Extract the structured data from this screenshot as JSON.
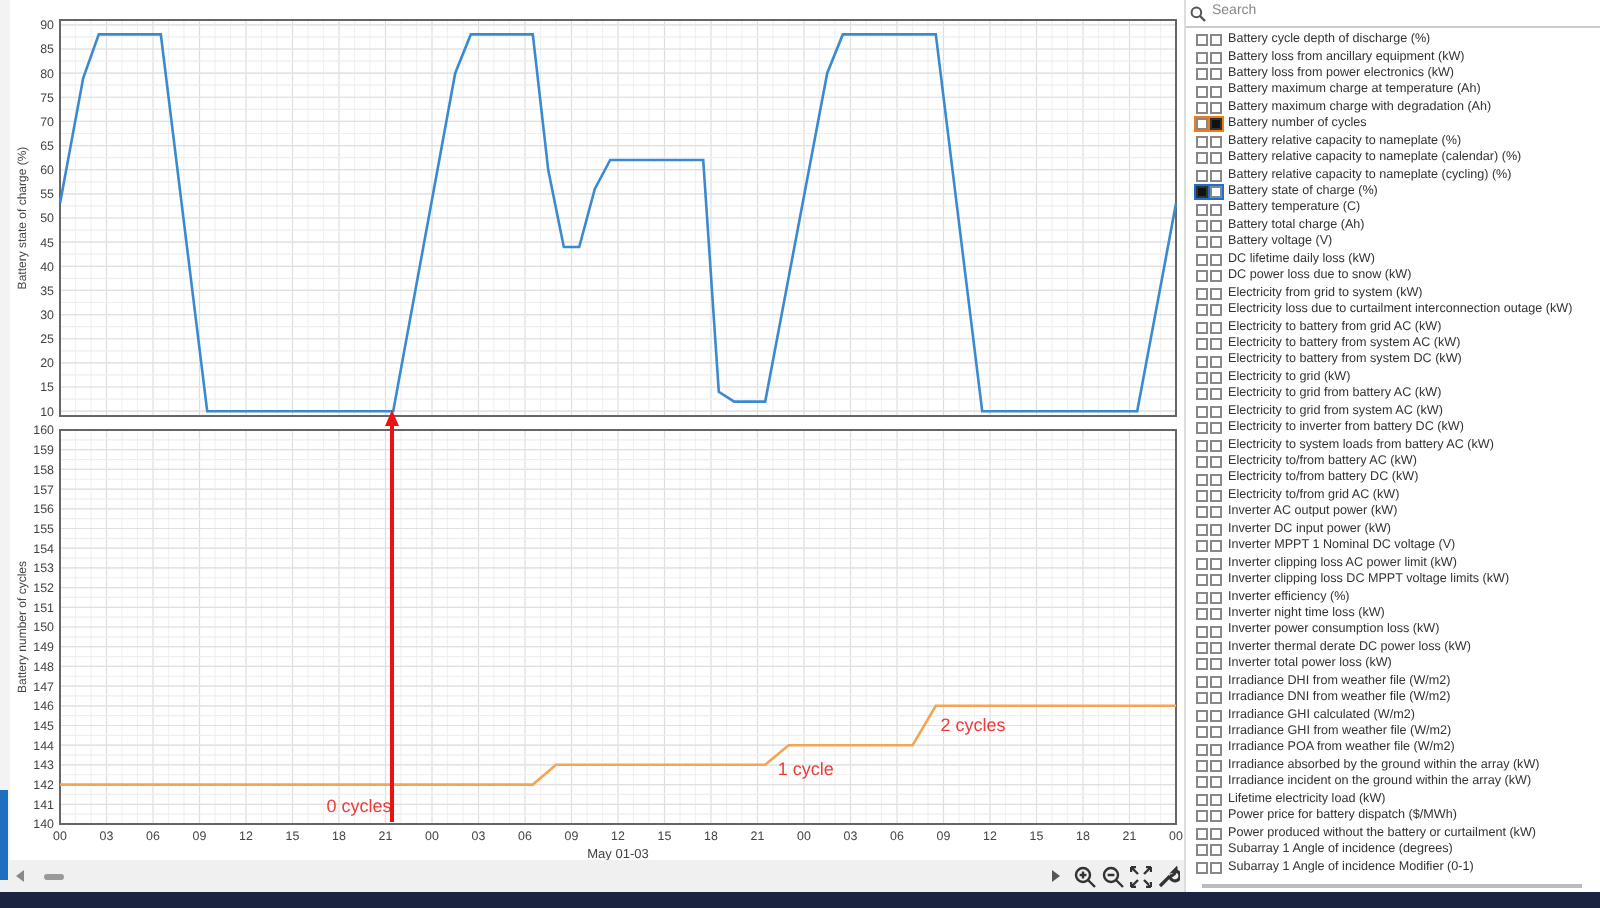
{
  "charts": [
    {
      "chart_data": {
        "type": "line",
        "ylabel": "Battery state of charge (%)",
        "x": [
          0,
          1.5,
          2.5,
          6.5,
          9.5,
          21.5,
          25.5,
          26.5,
          30.5,
          31.5,
          32.5,
          33.5,
          34.5,
          35.5,
          41.5,
          42.5,
          43.5,
          45.5,
          49.5,
          50.5,
          56.5,
          59.5,
          69.5,
          72
        ],
        "series": [
          {
            "color": "#3b8ad0",
            "values": [
              53,
              79,
              88,
              88,
              10,
              10,
              80,
              88,
              88,
              60,
              44,
              44,
              56,
              62,
              62,
              14,
              12,
              12,
              80,
              88,
              88,
              10,
              10,
              53
            ]
          }
        ],
        "xlim": [
          0,
          72
        ],
        "ylim": [
          9,
          91
        ],
        "grid": true,
        "yticks": [
          10,
          15,
          20,
          25,
          30,
          35,
          40,
          45,
          50,
          55,
          60,
          65,
          70,
          75,
          80,
          85,
          90
        ]
      }
    },
    {
      "chart_data": {
        "type": "line",
        "ylabel": "Battery number of cycles",
        "xlabel": "May 01-03",
        "x": [
          0,
          30.5,
          32,
          45.5,
          47,
          55,
          56.5,
          72
        ],
        "series": [
          {
            "color": "#f5a455",
            "values": [
              142,
              142,
              143,
              143,
              144,
              144,
              146,
              146
            ]
          }
        ],
        "xlim": [
          0,
          72
        ],
        "ylim": [
          140,
          160
        ],
        "grid": true,
        "yticks": [
          140,
          141,
          142,
          143,
          144,
          145,
          146,
          147,
          148,
          149,
          150,
          151,
          152,
          153,
          154,
          155,
          156,
          157,
          158,
          159,
          160
        ],
        "xticks": [
          {
            "value": 0,
            "label": "00"
          },
          {
            "value": 3,
            "label": "03"
          },
          {
            "value": 6,
            "label": "06"
          },
          {
            "value": 9,
            "label": "09"
          },
          {
            "value": 12,
            "label": "12"
          },
          {
            "value": 15,
            "label": "15"
          },
          {
            "value": 18,
            "label": "18"
          },
          {
            "value": 21,
            "label": "21"
          },
          {
            "value": 24,
            "label": "00"
          },
          {
            "value": 27,
            "label": "03"
          },
          {
            "value": 30,
            "label": "06"
          },
          {
            "value": 33,
            "label": "09"
          },
          {
            "value": 36,
            "label": "12"
          },
          {
            "value": 39,
            "label": "15"
          },
          {
            "value": 42,
            "label": "18"
          },
          {
            "value": 45,
            "label": "21"
          },
          {
            "value": 48,
            "label": "00"
          },
          {
            "value": 51,
            "label": "03"
          },
          {
            "value": 54,
            "label": "06"
          },
          {
            "value": 57,
            "label": "09"
          },
          {
            "value": 60,
            "label": "12"
          },
          {
            "value": 63,
            "label": "15"
          },
          {
            "value": 66,
            "label": "18"
          },
          {
            "value": 69,
            "label": "21"
          },
          {
            "value": 72,
            "label": "00"
          }
        ],
        "annotations": [
          "0 cycles",
          "1 cycle",
          "2 cycles"
        ]
      }
    }
  ],
  "search": {
    "placeholder": "Search"
  },
  "variables": [
    {
      "label": "Battery cycle depth of discharge (%)",
      "left_checked": false,
      "right_checked": false
    },
    {
      "label": "Battery loss from ancillary equipment (kW)",
      "left_checked": false,
      "right_checked": false
    },
    {
      "label": "Battery loss from power electronics (kW)",
      "left_checked": false,
      "right_checked": false
    },
    {
      "label": "Battery maximum charge at temperature (Ah)",
      "left_checked": false,
      "right_checked": false
    },
    {
      "label": "Battery maximum charge with degradation (Ah)",
      "left_checked": false,
      "right_checked": false
    },
    {
      "label": "Battery number of cycles",
      "left_checked": false,
      "right_checked": true,
      "color": "#f07d1a"
    },
    {
      "label": "Battery relative capacity to nameplate (%)",
      "left_checked": false,
      "right_checked": false
    },
    {
      "label": "Battery relative capacity to nameplate (calendar) (%)",
      "left_checked": false,
      "right_checked": false
    },
    {
      "label": "Battery relative capacity to nameplate (cycling) (%)",
      "left_checked": false,
      "right_checked": false
    },
    {
      "label": "Battery state of charge (%)",
      "left_checked": true,
      "right_checked": false,
      "color": "#1f6fc9"
    },
    {
      "label": "Battery temperature (C)",
      "left_checked": false,
      "right_checked": false
    },
    {
      "label": "Battery total charge (Ah)",
      "left_checked": false,
      "right_checked": false
    },
    {
      "label": "Battery voltage (V)",
      "left_checked": false,
      "right_checked": false
    },
    {
      "label": "DC lifetime daily loss (kW)",
      "left_checked": false,
      "right_checked": false
    },
    {
      "label": "DC power loss due to snow (kW)",
      "left_checked": false,
      "right_checked": false
    },
    {
      "label": "Electricity from grid to system (kW)",
      "left_checked": false,
      "right_checked": false
    },
    {
      "label": "Electricity loss due to curtailment interconnection outage (kW)",
      "left_checked": false,
      "right_checked": false
    },
    {
      "label": "Electricity to battery from grid AC (kW)",
      "left_checked": false,
      "right_checked": false
    },
    {
      "label": "Electricity to battery from system AC (kW)",
      "left_checked": false,
      "right_checked": false
    },
    {
      "label": "Electricity to battery from system DC (kW)",
      "left_checked": false,
      "right_checked": false
    },
    {
      "label": "Electricity to grid (kW)",
      "left_checked": false,
      "right_checked": false
    },
    {
      "label": "Electricity to grid from battery AC (kW)",
      "left_checked": false,
      "right_checked": false
    },
    {
      "label": "Electricity to grid from system AC (kW)",
      "left_checked": false,
      "right_checked": false
    },
    {
      "label": "Electricity to inverter from battery DC (kW)",
      "left_checked": false,
      "right_checked": false
    },
    {
      "label": "Electricity to system loads from battery AC (kW)",
      "left_checked": false,
      "right_checked": false
    },
    {
      "label": "Electricity to/from battery AC (kW)",
      "left_checked": false,
      "right_checked": false
    },
    {
      "label": "Electricity to/from battery DC (kW)",
      "left_checked": false,
      "right_checked": false
    },
    {
      "label": "Electricity to/from grid AC (kW)",
      "left_checked": false,
      "right_checked": false
    },
    {
      "label": "Inverter AC output power (kW)",
      "left_checked": false,
      "right_checked": false
    },
    {
      "label": "Inverter DC input power (kW)",
      "left_checked": false,
      "right_checked": false
    },
    {
      "label": "Inverter MPPT 1 Nominal DC voltage (V)",
      "left_checked": false,
      "right_checked": false
    },
    {
      "label": "Inverter clipping loss AC power limit (kW)",
      "left_checked": false,
      "right_checked": false
    },
    {
      "label": "Inverter clipping loss DC MPPT voltage limits (kW)",
      "left_checked": false,
      "right_checked": false
    },
    {
      "label": "Inverter efficiency (%)",
      "left_checked": false,
      "right_checked": false
    },
    {
      "label": "Inverter night time loss (kW)",
      "left_checked": false,
      "right_checked": false
    },
    {
      "label": "Inverter power consumption loss (kW)",
      "left_checked": false,
      "right_checked": false
    },
    {
      "label": "Inverter thermal derate DC power loss (kW)",
      "left_checked": false,
      "right_checked": false
    },
    {
      "label": "Inverter total power loss (kW)",
      "left_checked": false,
      "right_checked": false
    },
    {
      "label": "Irradiance DHI from weather file (W/m2)",
      "left_checked": false,
      "right_checked": false
    },
    {
      "label": "Irradiance DNI from weather file (W/m2)",
      "left_checked": false,
      "right_checked": false
    },
    {
      "label": "Irradiance GHI calculated (W/m2)",
      "left_checked": false,
      "right_checked": false
    },
    {
      "label": "Irradiance GHI from weather file (W/m2)",
      "left_checked": false,
      "right_checked": false
    },
    {
      "label": "Irradiance POA from weather file (W/m2)",
      "left_checked": false,
      "right_checked": false
    },
    {
      "label": "Irradiance absorbed by the ground within the array (kW)",
      "left_checked": false,
      "right_checked": false
    },
    {
      "label": "Irradiance incident on the ground within the array (kW)",
      "left_checked": false,
      "right_checked": false
    },
    {
      "label": "Lifetime electricity load (kW)",
      "left_checked": false,
      "right_checked": false
    },
    {
      "label": "Power price for battery dispatch ($/MWh)",
      "left_checked": false,
      "right_checked": false
    },
    {
      "label": "Power produced without the battery or curtailment (kW)",
      "left_checked": false,
      "right_checked": false
    },
    {
      "label": "Subarray 1 Angle of incidence (degrees)",
      "left_checked": false,
      "right_checked": false
    },
    {
      "label": "Subarray 1 Angle of incidence Modifier (0-1)",
      "left_checked": false,
      "right_checked": false
    }
  ]
}
